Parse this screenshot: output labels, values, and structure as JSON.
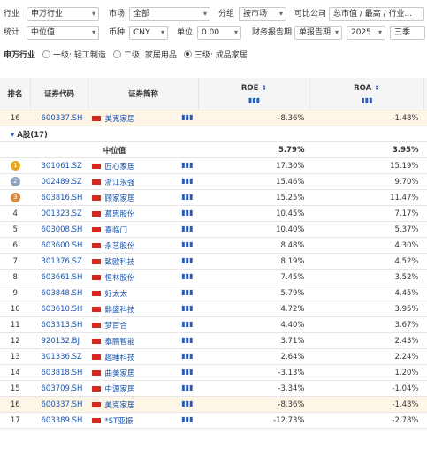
{
  "filters": {
    "row1": [
      {
        "label": "行业",
        "value": "申万行业"
      },
      {
        "label": "市场",
        "value": "全部"
      },
      {
        "label": "分组",
        "value": "按市场"
      },
      {
        "label": "可比公司",
        "value": "总市值 / 最高 / 行业..."
      }
    ],
    "row2": [
      {
        "label": "统计",
        "value": "中位值"
      },
      {
        "label": "币种",
        "value": "CNY"
      },
      {
        "label": "单位",
        "value": "0.00"
      },
      {
        "label": "财务报告期",
        "value": "单报告期"
      },
      {
        "label": "",
        "value": "2025"
      },
      {
        "label": "",
        "value": "三季"
      }
    ],
    "industry_label": "申万行业",
    "levels": [
      "一级: 轻工制造",
      "二级: 家居用品",
      "三级: 成品家居"
    ],
    "selected_level": 2
  },
  "table": {
    "headers": {
      "rank": "排名",
      "code": "证券代码",
      "name": "证券简称",
      "roe": "ROE",
      "roa": "ROA"
    },
    "pinned": {
      "rank": "16",
      "code": "600337.SH",
      "name": "美克家居",
      "roe": "-8.36%",
      "roa": "-1.48%"
    },
    "group_label": "A股(17)",
    "median": {
      "label": "中位值",
      "roe": "5.79%",
      "roa": "3.95%"
    },
    "rows": [
      {
        "rank": "1",
        "code": "301061.SZ",
        "name": "匠心家居",
        "roe": "17.30%",
        "roa": "15.19%"
      },
      {
        "rank": "2",
        "code": "002489.SZ",
        "name": "浙江永强",
        "roe": "15.46%",
        "roa": "9.70%"
      },
      {
        "rank": "3",
        "code": "603816.SH",
        "name": "顾家家居",
        "roe": "15.25%",
        "roa": "11.47%"
      },
      {
        "rank": "4",
        "code": "001323.SZ",
        "name": "慕思股份",
        "roe": "10.45%",
        "roa": "7.17%"
      },
      {
        "rank": "5",
        "code": "603008.SH",
        "name": "喜临门",
        "roe": "10.40%",
        "roa": "5.37%"
      },
      {
        "rank": "6",
        "code": "603600.SH",
        "name": "永艺股份",
        "roe": "8.48%",
        "roa": "4.30%"
      },
      {
        "rank": "7",
        "code": "301376.SZ",
        "name": "致欧科技",
        "roe": "8.19%",
        "roa": "4.52%"
      },
      {
        "rank": "8",
        "code": "603661.SH",
        "name": "恒林股份",
        "roe": "7.45%",
        "roa": "3.52%"
      },
      {
        "rank": "9",
        "code": "603848.SH",
        "name": "好太太",
        "roe": "5.79%",
        "roa": "4.45%"
      },
      {
        "rank": "10",
        "code": "603610.SH",
        "name": "麒盛科技",
        "roe": "4.72%",
        "roa": "3.95%"
      },
      {
        "rank": "11",
        "code": "603313.SH",
        "name": "梦百合",
        "roe": "4.40%",
        "roa": "3.67%"
      },
      {
        "rank": "12",
        "code": "920132.BJ",
        "name": "泰鹏智能",
        "roe": "3.71%",
        "roa": "2.43%"
      },
      {
        "rank": "13",
        "code": "301336.SZ",
        "name": "趣睡科技",
        "roe": "2.64%",
        "roa": "2.24%"
      },
      {
        "rank": "14",
        "code": "603818.SH",
        "name": "曲美家居",
        "roe": "-3.13%",
        "roa": "1.20%"
      },
      {
        "rank": "15",
        "code": "603709.SH",
        "name": "中源家居",
        "roe": "-3.34%",
        "roa": "-1.04%"
      },
      {
        "rank": "16",
        "code": "600337.SH",
        "name": "美克家居",
        "roe": "-8.36%",
        "roa": "-1.48%"
      },
      {
        "rank": "17",
        "code": "603389.SH",
        "name": "*ST亚振",
        "roe": "-12.73%",
        "roa": "-2.78%"
      }
    ]
  }
}
